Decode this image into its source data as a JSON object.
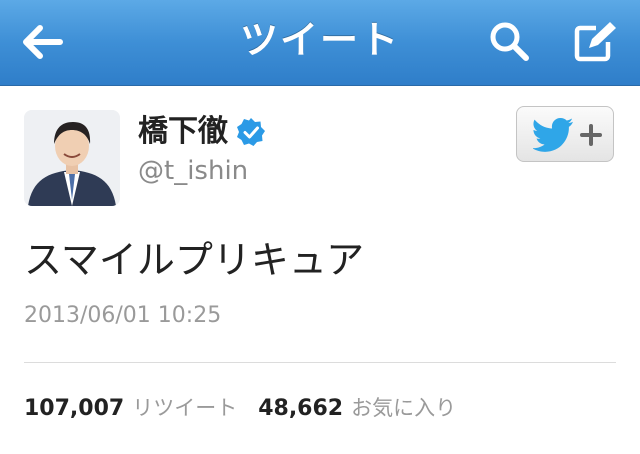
{
  "nav": {
    "title": "ツイート",
    "back_icon": "back-arrow-icon",
    "search_icon": "search-icon",
    "compose_icon": "compose-icon"
  },
  "tweet": {
    "display_name": "橋下徹",
    "verified": true,
    "handle": "@t_ishin",
    "text": "スマイルプリキュア",
    "timestamp": "2013/06/01 10:25"
  },
  "stats": {
    "retweet_count": "107,007",
    "retweet_label": "リツイート",
    "favorite_count": "48,662",
    "favorite_label": "お気に入り"
  },
  "colors": {
    "nav_bar": "#3e8fd6",
    "verified_badge": "#2b9ae6",
    "twitter_bird": "#2fa6e8"
  }
}
